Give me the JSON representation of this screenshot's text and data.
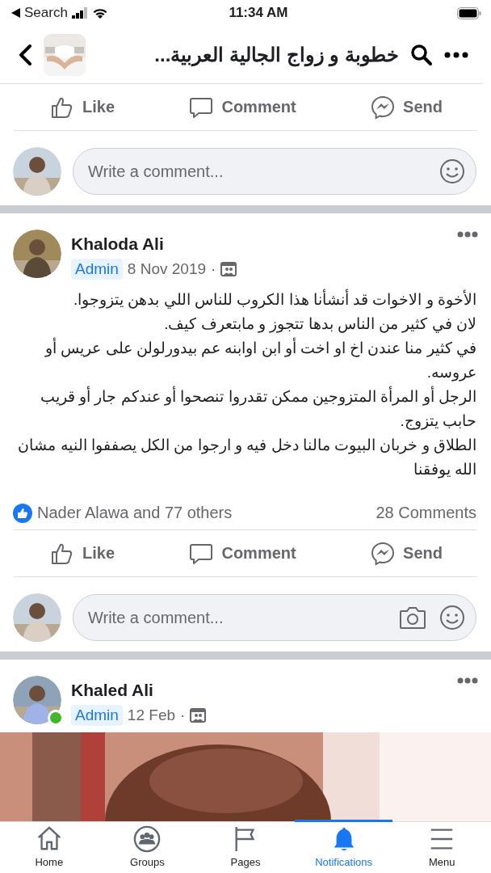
{
  "status_bar": {
    "back_label": "Search",
    "time": "11:34 AM"
  },
  "header": {
    "title": "خطوبة و زواج الجالية العربية..."
  },
  "previous_post": {
    "actions": [
      {
        "kind": "like",
        "label": "Like"
      },
      {
        "kind": "comment",
        "label": "Comment"
      },
      {
        "kind": "send",
        "label": "Send"
      }
    ],
    "comment_box": {
      "placeholder": "Write a comment...",
      "camera": false
    }
  },
  "posts": [
    {
      "author": "Khaloda Ali",
      "badge": "Admin",
      "date": "8 Nov 2019",
      "separator": "·",
      "online": false,
      "text": "الأخوة و الاخوات قد أنشأنا هذا الكروب للناس اللي بدهن يتزوجوا.\nلان في كثير من الناس بدها تتجوز و مابتعرف كيف.\nفي كثير منا عندن  اخ او اخت أو ابن اوابنه عم بيدورلولن على عريس أو عروسه.\nالرجل أو المرأة المتزوجين ممكن تقدروا تنصحوا أو عندكم جار أو قريب حابب يتزوج.\nالطلاق و خربان البيوت مالنا دخل فيه و ارجوا من الكل يصففوا النيه مشان الله يوفقنا",
      "reactions": "Nader Alawa and 77 others",
      "comments": "28 Comments",
      "actions": [
        {
          "kind": "like",
          "label": "Like"
        },
        {
          "kind": "comment",
          "label": "Comment"
        },
        {
          "kind": "send",
          "label": "Send"
        }
      ],
      "comment_box": {
        "placeholder": "Write a comment...",
        "camera": true
      }
    },
    {
      "author": "Khaled Ali",
      "badge": "Admin",
      "date": "12 Feb",
      "separator": "·",
      "online": true
    }
  ],
  "bottom_nav": [
    {
      "kind": "home",
      "label": "Home",
      "selected": false
    },
    {
      "kind": "groups",
      "label": "Groups",
      "selected": false
    },
    {
      "kind": "pages",
      "label": "Pages",
      "selected": false
    },
    {
      "kind": "notifications",
      "label": "Notifications",
      "selected": true
    },
    {
      "kind": "menu",
      "label": "Menu",
      "selected": false
    }
  ]
}
